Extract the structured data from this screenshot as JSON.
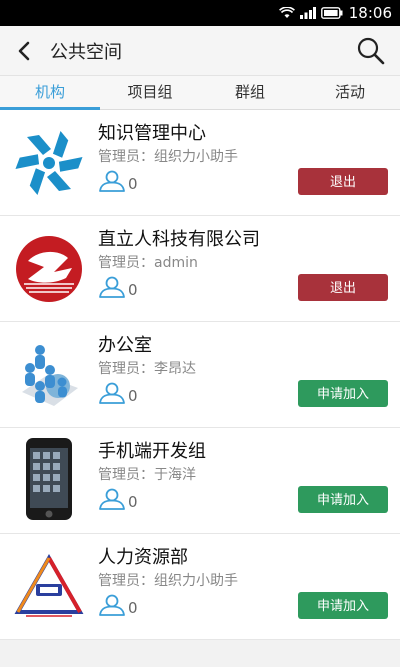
{
  "status_bar": {
    "time": "18:06"
  },
  "app_bar": {
    "title": "公共空间"
  },
  "tabs": [
    {
      "label": "机构",
      "active": true
    },
    {
      "label": "项目组",
      "active": false
    },
    {
      "label": "群组",
      "active": false
    },
    {
      "label": "活动",
      "active": false
    }
  ],
  "orgs": [
    {
      "name": "知识管理中心",
      "admin": "管理员：组织力小助手",
      "members": "0",
      "action": "退出",
      "action_type": "quit"
    },
    {
      "name": "直立人科技有限公司",
      "admin": "管理员：admin",
      "members": "0",
      "action": "退出",
      "action_type": "quit"
    },
    {
      "name": "办公室",
      "admin": "管理员：李昂达",
      "members": "0",
      "action": "申请加入",
      "action_type": "join"
    },
    {
      "name": "手机端开发组",
      "admin": "管理员：于海洋",
      "members": "0",
      "action": "申请加入",
      "action_type": "join"
    },
    {
      "name": "人力资源部",
      "admin": "管理员：组织力小助手",
      "members": "0",
      "action": "申请加入",
      "action_type": "join"
    }
  ],
  "colors": {
    "accent": "#3a9ed8",
    "quit": "#a8323b",
    "join": "#2e9a5d"
  },
  "icons": {
    "back": "chevron-left-icon",
    "search": "search-icon",
    "member": "person-icon",
    "wifi": "wifi-icon",
    "signal": "signal-icon",
    "battery": "battery-icon"
  }
}
